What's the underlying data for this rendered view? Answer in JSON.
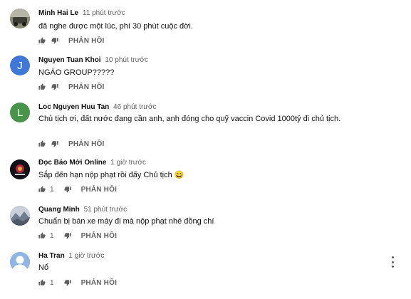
{
  "comments": [
    {
      "author": "Minh Hai Le",
      "time": "11 phút trước",
      "text": "đã nghe được một lúc, phí 30 phút cuộc đời.",
      "likes": "",
      "reply_label": "PHẢN HỒI",
      "avatar_icon": "photo-avatar",
      "avatar_color": "#6b6b58",
      "avatar_letter": ""
    },
    {
      "author": "Nguyen Tuan Khoi",
      "time": "10 phút trước",
      "text": "NGÁO GROUP?????",
      "likes": "",
      "reply_label": "PHẢN HỒI",
      "avatar_icon": "letter-avatar",
      "avatar_color": "#3f78d8",
      "avatar_letter": "J"
    },
    {
      "author": "Loc Nguyen Huu Tan",
      "time": "46 phút trước",
      "text": "Chủ tịch ơi, đất nước đang cần anh, anh đóng cho quỹ vaccin Covid 1000tỷ đi chủ tịch.",
      "likes": "",
      "reply_label": "PHẢN HỒI",
      "avatar_icon": "letter-avatar",
      "avatar_color": "#47944a",
      "avatar_letter": "L"
    },
    {
      "author": "Đọc Báo Mới Online",
      "time": "1 giờ trước",
      "text": "Sắp đến hạn nộp phạt rồi đấy Chủ tịch 😄",
      "likes": "1",
      "reply_label": "PHẢN HỒI",
      "avatar_icon": "photo-avatar",
      "avatar_color": "#101018",
      "avatar_letter": ""
    },
    {
      "author": "Quang Minh",
      "time": "51 phút trước",
      "text": "Chuẩn bị bán xe máy đi mà nộp phạt nhé đồng chí",
      "likes": "1",
      "reply_label": "PHẢN HỒI",
      "avatar_icon": "photo-avatar",
      "avatar_color": "#8f9aa8",
      "avatar_letter": ""
    },
    {
      "author": "Ha Tran",
      "time": "1 giờ trước",
      "text": "Nổ",
      "likes": "1",
      "reply_label": "PHẢN HỒI",
      "avatar_icon": "default-user-avatar",
      "avatar_color": "#8fb4e6",
      "avatar_letter": ""
    }
  ],
  "icons": {
    "like": "thumbs-up-icon",
    "dislike": "thumbs-down-icon",
    "more": "more-vertical-icon"
  },
  "colors": {
    "text": "#0f0f0f",
    "secondary": "#606060"
  }
}
